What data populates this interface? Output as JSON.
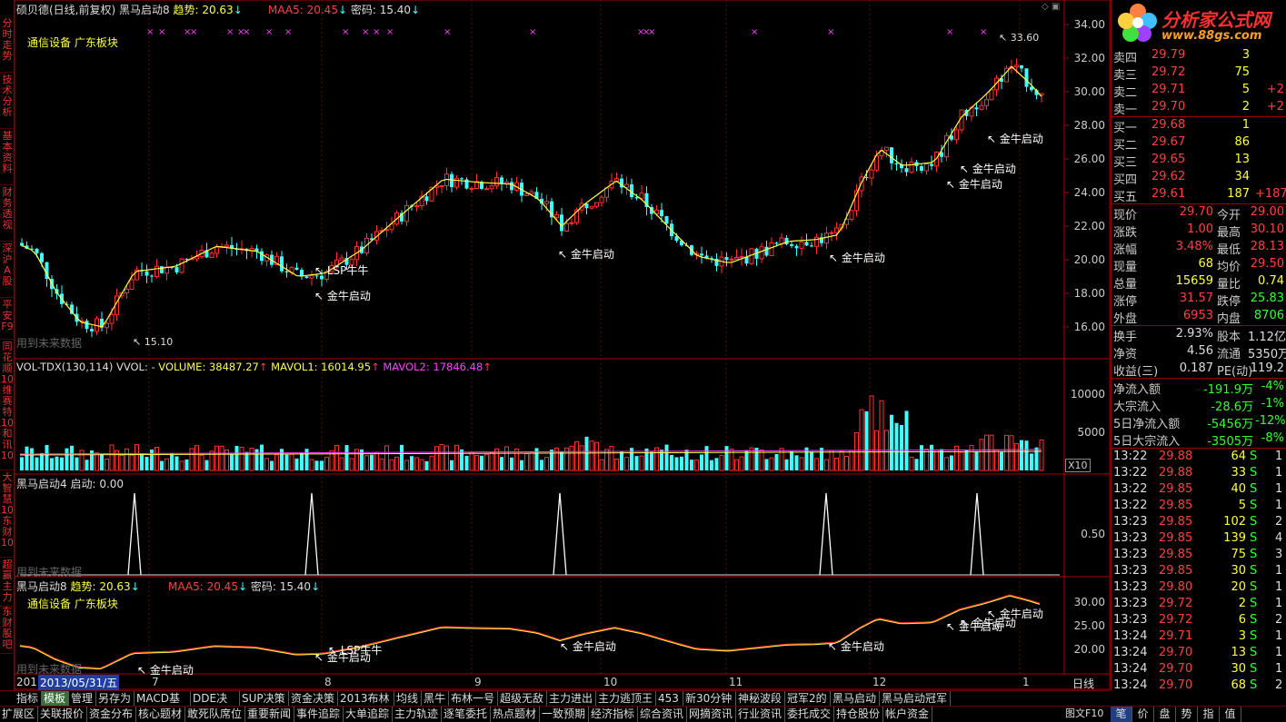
{
  "header": {
    "title": "硕贝德(日线,前复权)",
    "indicator": "黑马启动8",
    "trend_label": "趋势: 20.63",
    "maa5_label": "MAA5: 20.45",
    "secret_label": "密码: 15.40"
  },
  "logo": {
    "name": "分析家公式网",
    "url": "www.88gs.com"
  },
  "chart_note": "通信设备 广东板块",
  "future_data_note": "用到未来数据",
  "price_axis": [
    "34.00",
    "32.00",
    "30.00",
    "28.00",
    "26.00",
    "24.00",
    "22.00",
    "20.00",
    "18.00",
    "16.00"
  ],
  "peak_label": "33.60",
  "low_label": "15.10",
  "annotations_main": [
    "LSP牛牛",
    "金牛启动",
    "金牛启动",
    "金牛启动",
    "金牛启动",
    "金牛启动",
    "金牛启动"
  ],
  "vol_header": {
    "name": "VOL-TDX(130,114)",
    "vvol": "VVOL: -",
    "volume": "VOLUME: 38487.27",
    "mavol1": "MAVOL1: 16014.95",
    "mavol2": "MAVOL2: 17846.48"
  },
  "vol_axis": [
    "10000",
    "5000"
  ],
  "vol_unit": "X10",
  "ind2_header": {
    "name": "黑马启动4",
    "value": "启动: 0.00"
  },
  "ind2_axis": "0.50",
  "ind3_header": {
    "name": "黑马启动8",
    "trend": "趋势: 20.63",
    "maa5": "MAA5: 20.45",
    "secret": "密码: 15.40"
  },
  "ind3_axis": [
    "30.00",
    "25.00",
    "20.00"
  ],
  "ind3_annotations": [
    "LSP牛牛",
    "金牛启动",
    "金牛启动",
    "金牛启动",
    "金牛启动",
    "金牛启动",
    "金牛启动",
    "金牛启动"
  ],
  "date_axis": {
    "current": "2013/05/31/五",
    "prefix": "201",
    "months": [
      "7",
      "8",
      "9",
      "10",
      "11",
      "12",
      "1"
    ],
    "period": "日线"
  },
  "side_tabs": [
    "分时走势",
    "技术分析",
    "基本资料",
    "财务透视",
    "深沪A股",
    "平安F9",
    "同花顺10",
    "维赛特10",
    "和讯10",
    "大智慧10",
    "东财10",
    "超赢主力",
    "东财股吧"
  ],
  "order_book": {
    "sell": [
      {
        "label": "卖四",
        "price": "29.79",
        "vol": "3",
        "chg": ""
      },
      {
        "label": "卖三",
        "price": "29.72",
        "vol": "75",
        "chg": ""
      },
      {
        "label": "卖二",
        "price": "29.71",
        "vol": "5",
        "chg": "+2"
      },
      {
        "label": "卖一",
        "price": "29.70",
        "vol": "2",
        "chg": "+2"
      }
    ],
    "buy": [
      {
        "label": "买一",
        "price": "29.68",
        "vol": "1",
        "chg": ""
      },
      {
        "label": "买二",
        "price": "29.67",
        "vol": "86",
        "chg": ""
      },
      {
        "label": "买三",
        "price": "29.65",
        "vol": "13",
        "chg": ""
      },
      {
        "label": "买四",
        "price": "29.62",
        "vol": "34",
        "chg": ""
      },
      {
        "label": "买五",
        "price": "29.61",
        "vol": "187",
        "chg": "+187"
      }
    ]
  },
  "quote": [
    {
      "l1": "现价",
      "v1": "29.70",
      "l2": "今开",
      "v2": "29.00"
    },
    {
      "l1": "涨跌",
      "v1": "1.00",
      "l2": "最高",
      "v2": "30.10"
    },
    {
      "l1": "涨幅",
      "v1": "3.48%",
      "l2": "最低",
      "v2": "28.13"
    },
    {
      "l1": "现量",
      "v1": "68",
      "l2": "均价",
      "v2": "29.50"
    },
    {
      "l1": "总量",
      "v1": "15659",
      "l2": "量比",
      "v2": "0.74"
    },
    {
      "l1": "涨停",
      "v1": "31.57",
      "l2": "跌停",
      "v2": "25.83"
    },
    {
      "l1": "外盘",
      "v1": "6953",
      "l2": "内盘",
      "v2": "8706"
    }
  ],
  "fundamentals": [
    {
      "l1": "换手",
      "v1": "2.93%",
      "l2": "股本",
      "v2": "1.12亿"
    },
    {
      "l1": "净资",
      "v1": "4.56",
      "l2": "流通",
      "v2": "5350万"
    },
    {
      "l1": "收益(三)",
      "v1": "0.187",
      "l2": "PE(动)",
      "v2": "119.2"
    }
  ],
  "flows": [
    {
      "l": "净流入额",
      "v": "-191.9万",
      "p": "-4%"
    },
    {
      "l": "大宗流入",
      "v": "-28.6万",
      "p": "-1%"
    },
    {
      "l": "5日净流入额",
      "v": "-5456万",
      "p": "-12%"
    },
    {
      "l": "5日大宗流入",
      "v": "-3505万",
      "p": "-8%"
    }
  ],
  "ticks": [
    {
      "t": "13:22",
      "p": "29.88",
      "v": "64",
      "s": "S",
      "n": "1"
    },
    {
      "t": "13:22",
      "p": "29.88",
      "v": "33",
      "s": "S",
      "n": "1"
    },
    {
      "t": "13:22",
      "p": "29.85",
      "v": "40",
      "s": "S",
      "n": "1"
    },
    {
      "t": "13:22",
      "p": "29.85",
      "v": "5",
      "s": "S",
      "n": "1"
    },
    {
      "t": "13:23",
      "p": "29.85",
      "v": "102",
      "s": "S",
      "n": "2"
    },
    {
      "t": "13:23",
      "p": "29.85",
      "v": "139",
      "s": "S",
      "n": "4"
    },
    {
      "t": "13:23",
      "p": "29.85",
      "v": "75",
      "s": "S",
      "n": "3"
    },
    {
      "t": "13:23",
      "p": "29.85",
      "v": "30",
      "s": "S",
      "n": "1"
    },
    {
      "t": "13:23",
      "p": "29.80",
      "v": "20",
      "s": "S",
      "n": "1"
    },
    {
      "t": "13:23",
      "p": "29.72",
      "v": "2",
      "s": "S",
      "n": "1"
    },
    {
      "t": "13:23",
      "p": "29.72",
      "v": "6",
      "s": "S",
      "n": "2"
    },
    {
      "t": "13:24",
      "p": "29.71",
      "v": "3",
      "s": "S",
      "n": "1"
    },
    {
      "t": "13:24",
      "p": "29.70",
      "v": "13",
      "s": "S",
      "n": "1"
    },
    {
      "t": "13:24",
      "p": "29.70",
      "v": "30",
      "s": "S",
      "n": "1"
    },
    {
      "t": "13:24",
      "p": "29.70",
      "v": "68",
      "s": "S",
      "n": "2"
    }
  ],
  "tabs_row1": [
    "指标",
    "模板",
    "管理",
    "另存为",
    "MACD基本",
    "DDE决策",
    "SUP决策",
    "资金决策",
    "2013布林",
    "均线",
    "黑牛",
    "布林一号",
    "超级无敌",
    "主力进出",
    "主力逃顶王",
    "453",
    "新30分钟",
    "神秘波段",
    "冠军2的",
    "黑马启动",
    "黑马启动冠军"
  ],
  "tabs_row2": [
    "扩展区",
    "关联报价",
    "资金分布",
    "核心题材",
    "敢死队席位",
    "重要新闻",
    "事件追踪",
    "大单追踪",
    "主力轨迹",
    "逐笔委托",
    "热点题材",
    "一致预期",
    "经济指标",
    "综合资讯",
    "网摘资讯",
    "行业资讯",
    "委托成交",
    "持仓股份",
    "帐户资金"
  ],
  "right_tabs": [
    "笔",
    "价",
    "盘",
    "势",
    "指",
    "值"
  ],
  "right_tab_extra": "图文F10",
  "colors": {
    "up": "#ff3030",
    "down": "#40ffff",
    "ma": "#ffff40",
    "frame": "#aa0000",
    "purple": "#ff40ff"
  }
}
